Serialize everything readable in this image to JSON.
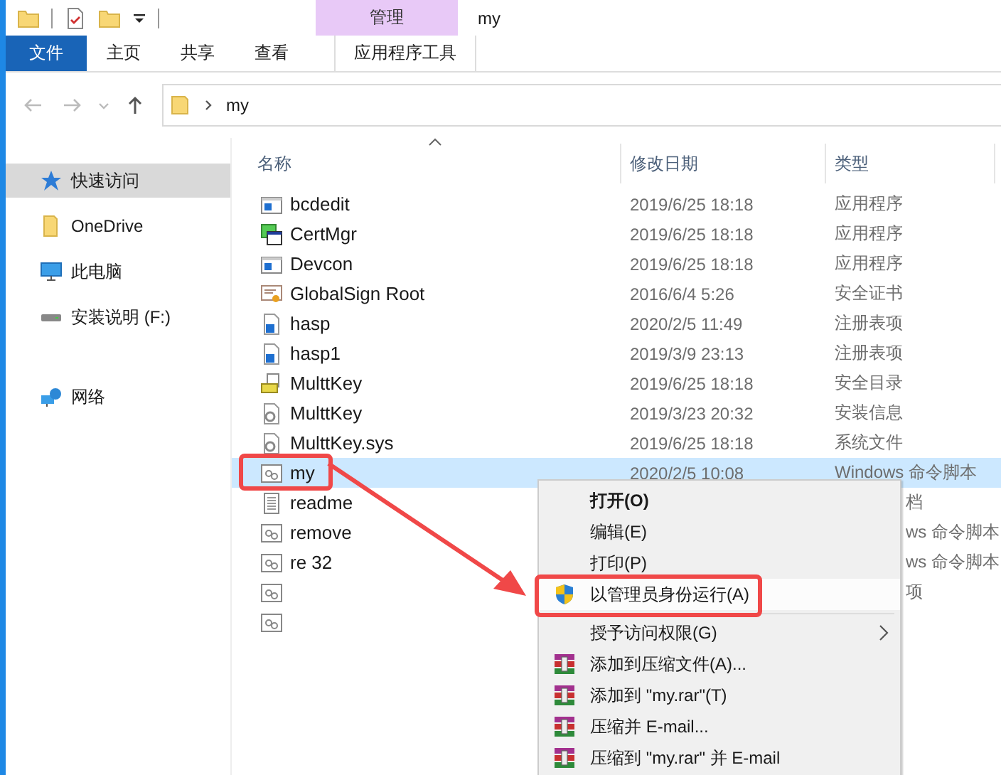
{
  "ribbon": {
    "context_header": "管理",
    "window_title": "my",
    "tabs": [
      {
        "label": "文件",
        "kind": "file"
      },
      {
        "label": "主页",
        "kind": "normal"
      },
      {
        "label": "共享",
        "kind": "normal"
      },
      {
        "label": "查看",
        "kind": "normal"
      },
      {
        "label": "应用程序工具",
        "kind": "context"
      }
    ]
  },
  "address": {
    "path": "my"
  },
  "sidebar": {
    "items": [
      {
        "label": "快速访问",
        "kind": "star",
        "selected": true
      },
      {
        "label": "OneDrive",
        "kind": "folder",
        "selected": false
      },
      {
        "label": "此电脑",
        "kind": "pc",
        "selected": false
      },
      {
        "label": "安装说明 (F:)",
        "kind": "drive",
        "selected": false
      },
      {
        "label": "网络",
        "kind": "network",
        "selected": false
      }
    ]
  },
  "table": {
    "columns": [
      "名称",
      "修改日期",
      "类型"
    ],
    "rows": [
      {
        "kind": "app",
        "name": "bcdedit",
        "date": "2019/6/25 18:18",
        "type": "应用程序",
        "selected": false
      },
      {
        "kind": "certapp",
        "name": "CertMgr",
        "date": "2019/6/25 18:18",
        "type": "应用程序",
        "selected": false
      },
      {
        "kind": "app",
        "name": "Devcon",
        "date": "2019/6/25 18:18",
        "type": "应用程序",
        "selected": false
      },
      {
        "kind": "cert",
        "name": "GlobalSign Root",
        "date": "2016/6/4 5:26",
        "type": "安全证书",
        "selected": false
      },
      {
        "kind": "reg",
        "name": "hasp",
        "date": "2020/2/5 11:49",
        "type": "注册表项",
        "selected": false
      },
      {
        "kind": "reg",
        "name": "hasp1",
        "date": "2019/3/9 23:13",
        "type": "注册表项",
        "selected": false
      },
      {
        "kind": "catalog",
        "name": "MulttKey",
        "date": "2019/6/25 18:18",
        "type": "安全目录",
        "selected": false
      },
      {
        "kind": "gear",
        "name": "MulttKey",
        "date": "2019/3/23 20:32",
        "type": "安装信息",
        "selected": false
      },
      {
        "kind": "gear",
        "name": "MulttKey.sys",
        "date": "2019/6/25 18:18",
        "type": "系统文件",
        "selected": false
      },
      {
        "kind": "script",
        "name": "my",
        "date": "2020/2/5 10:08",
        "type": "Windows 命令脚本",
        "selected": true
      },
      {
        "kind": "text",
        "name": "readme",
        "type": "档",
        "selected": false
      },
      {
        "kind": "script",
        "name": "remove",
        "type": "ws 命令脚本",
        "selected": false
      },
      {
        "kind": "script",
        "name": "re  32",
        "type": "ws 命令脚本",
        "selected": false
      },
      {
        "kind": "script",
        "type": "项",
        "selected": false
      },
      {
        "kind": "script",
        "selected": false
      }
    ]
  },
  "context_menu": {
    "items": [
      {
        "kind": "item",
        "label": "打开(O)",
        "default": true,
        "highlighted": false
      },
      {
        "kind": "item",
        "label": "编辑(E)",
        "default": false,
        "highlighted": false
      },
      {
        "kind": "item",
        "label": "打印(P)",
        "default": false,
        "highlighted": false
      },
      {
        "kind": "shield",
        "label": "以管理员身份运行(A)",
        "default": false,
        "highlighted": true
      },
      {
        "kind": "separator"
      },
      {
        "kind": "submenu",
        "label": "授予访问权限(G)",
        "default": false,
        "highlighted": false
      },
      {
        "kind": "archive",
        "label": "添加到压缩文件(A)...",
        "default": false,
        "highlighted": false
      },
      {
        "kind": "archive",
        "label": "添加到 \"my.rar\"(T)",
        "default": false,
        "highlighted": false
      },
      {
        "kind": "archive",
        "label": "压缩并 E-mail...",
        "default": false,
        "highlighted": false
      },
      {
        "kind": "archive",
        "label": "压缩到 \"my.rar\" 并 E-mail",
        "default": false,
        "highlighted": false
      }
    ]
  }
}
